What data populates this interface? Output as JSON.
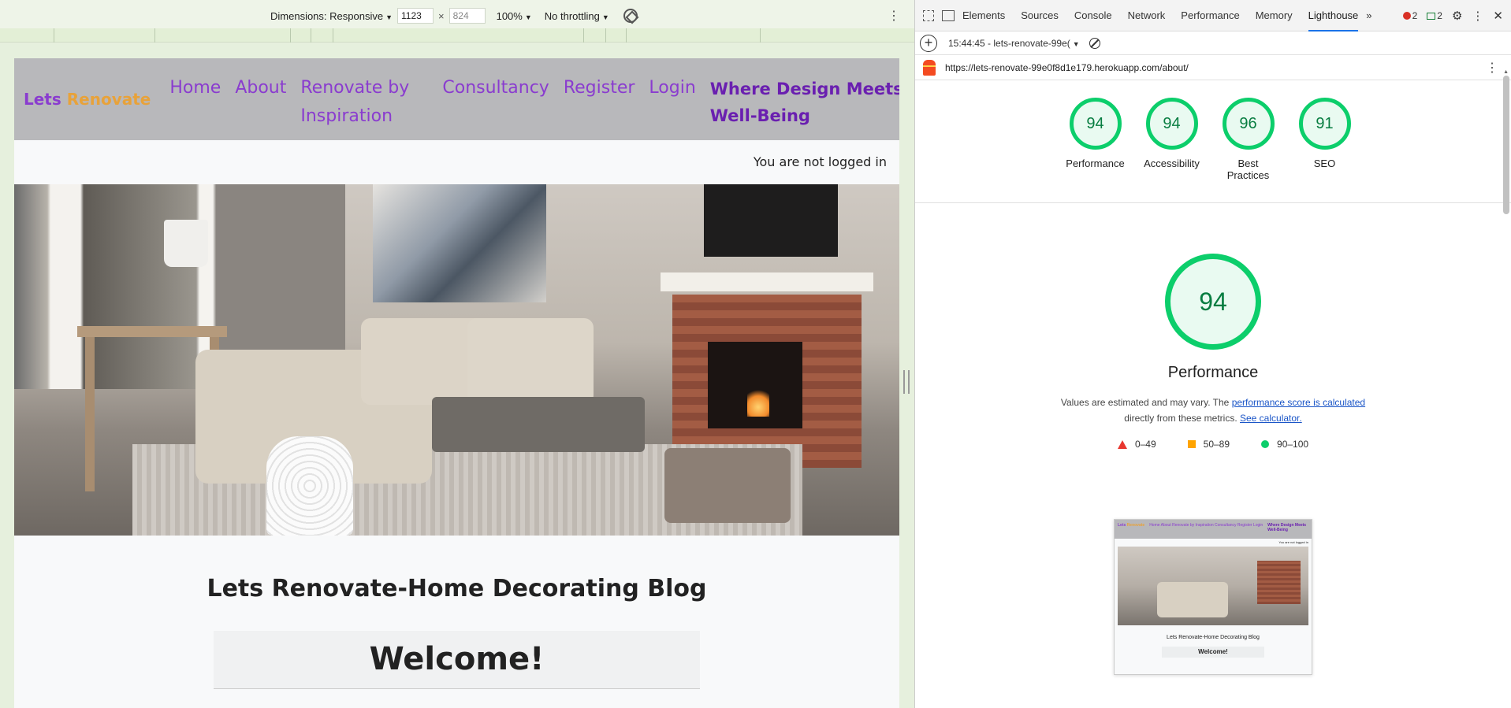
{
  "device_toolbar": {
    "dimensions_label": "Dimensions: Responsive",
    "width": "1123",
    "times": "×",
    "height": "824",
    "zoom": "100%",
    "throttling": "No throttling"
  },
  "site": {
    "brand_part1": "Lets",
    "brand_part2": "Renovate",
    "nav": [
      "Home",
      "About",
      "Renovate by Inspiration",
      "Consultancy",
      "Register",
      "Login"
    ],
    "tagline": "Where Design Meets Well-Being",
    "login_status": "You are not logged in",
    "blog_title": "Lets Renovate-Home Decorating Blog",
    "welcome": "Welcome!"
  },
  "devtools": {
    "tabs": [
      "Elements",
      "Sources",
      "Console",
      "Network",
      "Performance",
      "Memory",
      "Lighthouse"
    ],
    "active_tab": "Lighthouse",
    "more_tabs": "»",
    "errors": "2",
    "messages": "2",
    "report_selector": "15:44:45 - lets-renovate-99e(",
    "url": "https://lets-renovate-99e0f8d1e179.herokuapp.com/about/",
    "scores": [
      {
        "value": "94",
        "label": "Performance"
      },
      {
        "value": "94",
        "label": "Accessibility"
      },
      {
        "value": "96",
        "label": "Best Practices"
      },
      {
        "value": "91",
        "label": "SEO"
      }
    ],
    "performance": {
      "score": "94",
      "title": "Performance",
      "desc_1": "Values are estimated and may vary. The",
      "desc_link1": "performance score is calculated",
      "desc_2": "directly from these metrics.",
      "desc_link2": "See calculator."
    },
    "legend": [
      "0–49",
      "50–89",
      "90–100"
    ],
    "colors": {
      "pass": "#0cce6b",
      "average": "#ffa400",
      "fail": "#e8372f"
    }
  },
  "thumbnail": {
    "brand_part1": "Lets",
    "brand_part2": "Renovate",
    "nav": "Home About Renovate by Inspiration Consultancy Register Login",
    "tagline": "Where Design Meets Well-Being",
    "login_status": "You are not logged in",
    "blog_title": "Lets Renovate-Home Decorating Blog",
    "welcome": "Welcome!"
  }
}
